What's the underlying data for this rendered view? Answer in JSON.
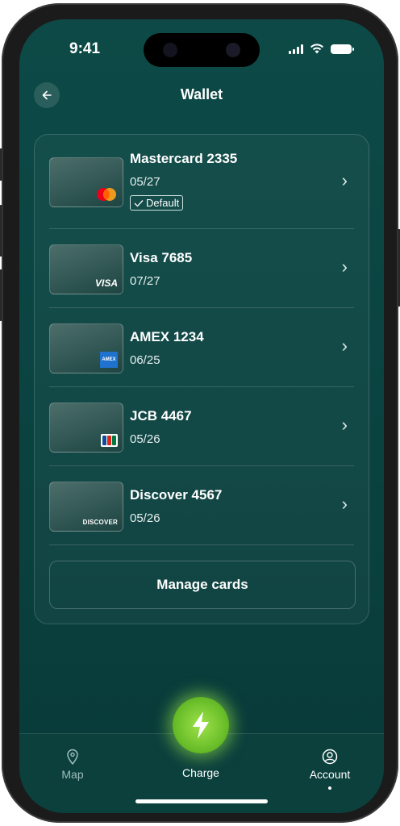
{
  "status": {
    "time": "9:41"
  },
  "header": {
    "title": "Wallet",
    "back_icon": "arrow-left-icon"
  },
  "cards": [
    {
      "name": "Mastercard 2335",
      "expiry": "05/27",
      "brand": "Mastercard",
      "default_label": "Default"
    },
    {
      "name": "Visa 7685",
      "expiry": "07/27",
      "brand": "VISA"
    },
    {
      "name": "AMEX 1234",
      "expiry": "06/25",
      "brand": "AMEX"
    },
    {
      "name": "JCB 4467",
      "expiry": "05/26",
      "brand": "JCB"
    },
    {
      "name": "Discover 4567",
      "expiry": "05/26",
      "brand": "DISCOVER"
    }
  ],
  "actions": {
    "manage_cards": "Manage cards"
  },
  "tabbar": {
    "map": "Map",
    "charge": "Charge",
    "account": "Account",
    "active": "Account"
  },
  "colors": {
    "background": "#0d4a47",
    "accent": "#8fdc3f"
  }
}
